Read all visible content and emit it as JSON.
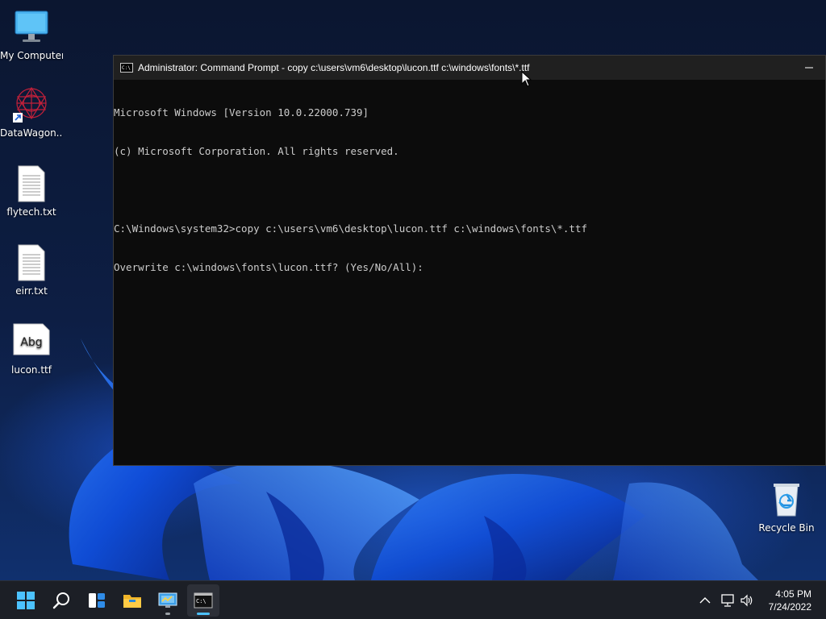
{
  "desktop": {
    "icons": [
      {
        "label": "My Computer",
        "icon": "monitor-icon"
      },
      {
        "label": "DataWagon...",
        "icon": "datawagon-shortcut-icon"
      },
      {
        "label": "flytech.txt",
        "icon": "text-file-icon"
      },
      {
        "label": "eirr.txt",
        "icon": "text-file-icon"
      },
      {
        "label": "lucon.ttf",
        "icon": "font-file-icon",
        "preview": "Abg"
      },
      {
        "label": "Recycle Bin",
        "icon": "recycle-bin-icon"
      }
    ]
  },
  "console": {
    "title": "Administrator: Command Prompt - copy  c:\\users\\vm6\\desktop\\lucon.ttf c:\\windows\\fonts\\*.ttf",
    "lines": [
      "Microsoft Windows [Version 10.0.22000.739]",
      "(c) Microsoft Corporation. All rights reserved.",
      "",
      "C:\\Windows\\system32>copy c:\\users\\vm6\\desktop\\lucon.ttf c:\\windows\\fonts\\*.ttf",
      "Overwrite c:\\windows\\fonts\\lucon.ttf? (Yes/No/All):"
    ],
    "colors": {
      "background": "#0c0c0c",
      "text": "#cccccc",
      "titlebar": "#202020"
    }
  },
  "taskbar": {
    "apps": [
      {
        "name": "start",
        "icon": "windows-start-icon"
      },
      {
        "name": "search",
        "icon": "search-icon"
      },
      {
        "name": "widgets",
        "icon": "widgets-icon"
      },
      {
        "name": "file-explorer",
        "icon": "folder-icon"
      },
      {
        "name": "control-panel",
        "icon": "control-panel-icon"
      },
      {
        "name": "command-prompt",
        "icon": "terminal-icon"
      }
    ],
    "tray": {
      "icons": [
        "chevron-up-icon",
        "network-icon",
        "volume-icon"
      ]
    },
    "clock": {
      "time": "4:05 PM",
      "date": "7/24/2022"
    },
    "colors": {
      "accent": "#4cc2ff",
      "background": "#1c1f26"
    }
  }
}
